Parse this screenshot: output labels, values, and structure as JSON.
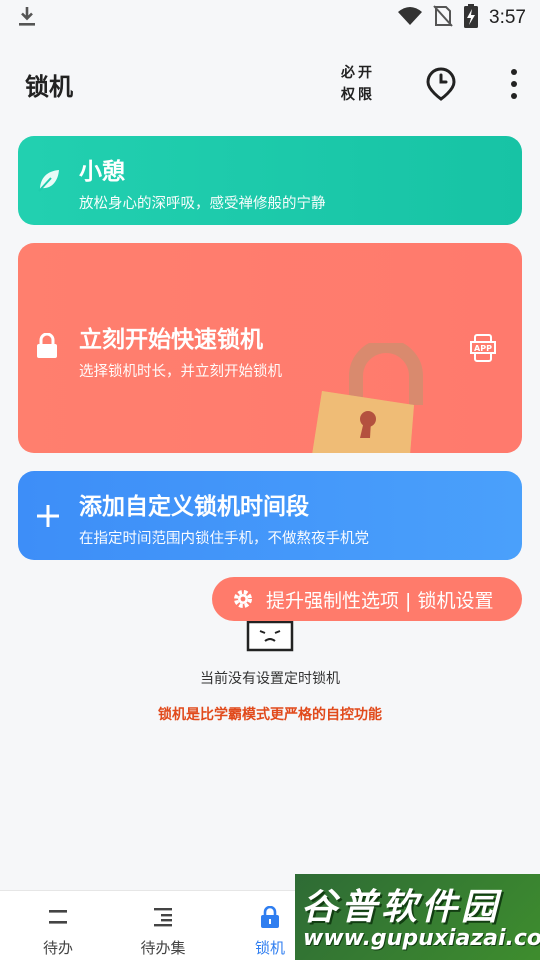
{
  "status_bar": {
    "time": "3:57",
    "icons": [
      "download-icon",
      "wifi-icon",
      "no-sim-icon",
      "battery-charging-icon"
    ]
  },
  "app_bar": {
    "title": "锁机",
    "permissions_line1": "必开",
    "permissions_line2": "权限",
    "icons": [
      "clock-pin-icon",
      "more-vert-icon"
    ]
  },
  "cards": {
    "rest": {
      "title": "小憩",
      "subtitle": "放松身心的深呼吸，感受禅修般的宁静",
      "icon": "leaf-icon",
      "color": "#1fcbad"
    },
    "quick_lock": {
      "title": "立刻开始快速锁机",
      "subtitle": "选择锁机时长，并立刻开始锁机",
      "icon": "lock-icon",
      "side_icon": "app-icon",
      "color": "#ff7d6d"
    },
    "custom": {
      "title": "添加自定义锁机时间段",
      "subtitle": "在指定时间范围内锁住手机，不做熬夜手机党",
      "icon": "plus-icon",
      "color": "#4296f9"
    }
  },
  "settings_pill": {
    "label": "提升强制性选项 | 锁机设置",
    "icon": "gear-icon"
  },
  "empty_state": {
    "message": "当前没有设置定时锁机",
    "promo": "锁机是比学霸模式更严格的自控功能",
    "promo_color": "#e14a1c"
  },
  "bottom_nav": {
    "items": [
      {
        "label": "待办",
        "icon": "todo-icon",
        "active": false
      },
      {
        "label": "待办集",
        "icon": "todo-list-icon",
        "active": false
      },
      {
        "label": "锁机",
        "icon": "lock-icon",
        "active": true
      }
    ],
    "active_color": "#2f7ef0"
  },
  "watermark": {
    "title": "谷普软件园",
    "url": "www.gupuxiazai.com"
  }
}
